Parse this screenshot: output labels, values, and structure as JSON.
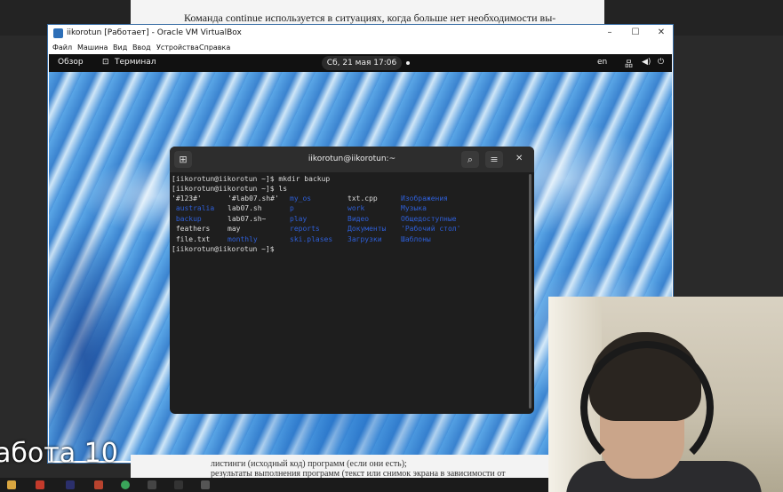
{
  "background_doc": {
    "top_text": "Команда continue используется в ситуациях, когда больше нет необходимости вы-",
    "bottom_lines": [
      "листинги (исходный код) программ (если они есть);",
      "результаты выполнения программ (текст или снимок экрана в зависимости от"
    ]
  },
  "overlay_title": "абота 10",
  "vbox": {
    "title": "iikorotun [Работает] - Oracle VM VirtualBox",
    "menu": [
      "Файл",
      "Машина",
      "Вид",
      "Ввод",
      "Устройства",
      "Справка"
    ],
    "controls": [
      "–",
      "☐",
      "✕"
    ]
  },
  "gnome_bar": {
    "activities": "Обзор",
    "app": "Терминал",
    "datetime": "Сб, 21 мая  17:06",
    "lang": "en",
    "icons": [
      "network-icon",
      "volume-icon",
      "power-icon"
    ]
  },
  "terminal": {
    "title": "iikorotun@iikorotun:~",
    "lines": [
      "[iikorotun@iikorotun ~]$ mkdir backup",
      "[iikorotun@iikorotun ~]$ ls",
      "[iikorotun@iikorotun ~]$ "
    ],
    "ls_rows": [
      [
        {
          "t": "'#123#'",
          "d": false
        },
        {
          "t": "'#lab07.sh#'",
          "d": false
        },
        {
          "t": "my_os",
          "d": true
        },
        {
          "t": "txt.cpp",
          "d": false
        },
        {
          "t": "Изображения",
          "d": true
        }
      ],
      [
        {
          "t": " australia",
          "d": true
        },
        {
          "t": "lab07.sh",
          "d": false
        },
        {
          "t": "p",
          "d": true
        },
        {
          "t": "work",
          "d": true
        },
        {
          "t": "Музыка",
          "d": true
        }
      ],
      [
        {
          "t": " backup",
          "d": true
        },
        {
          "t": "lab07.sh~",
          "d": false
        },
        {
          "t": "play",
          "d": true
        },
        {
          "t": "Видео",
          "d": true
        },
        {
          "t": "Общедоступные",
          "d": true
        }
      ],
      [
        {
          "t": " feathers",
          "d": false
        },
        {
          "t": "may",
          "d": false
        },
        {
          "t": "reports",
          "d": true
        },
        {
          "t": "Документы",
          "d": true
        },
        {
          "t": "'Рабочий стол'",
          "d": true
        }
      ],
      [
        {
          "t": " file.txt",
          "d": false
        },
        {
          "t": "monthly",
          "d": true
        },
        {
          "t": "ski.plases",
          "d": true
        },
        {
          "t": "Загрузки",
          "d": true
        },
        {
          "t": "Шаблоны",
          "d": true
        }
      ]
    ]
  },
  "colors": {
    "dir_color": "#2e5fd8",
    "terminal_bg": "#1e1e1e"
  }
}
